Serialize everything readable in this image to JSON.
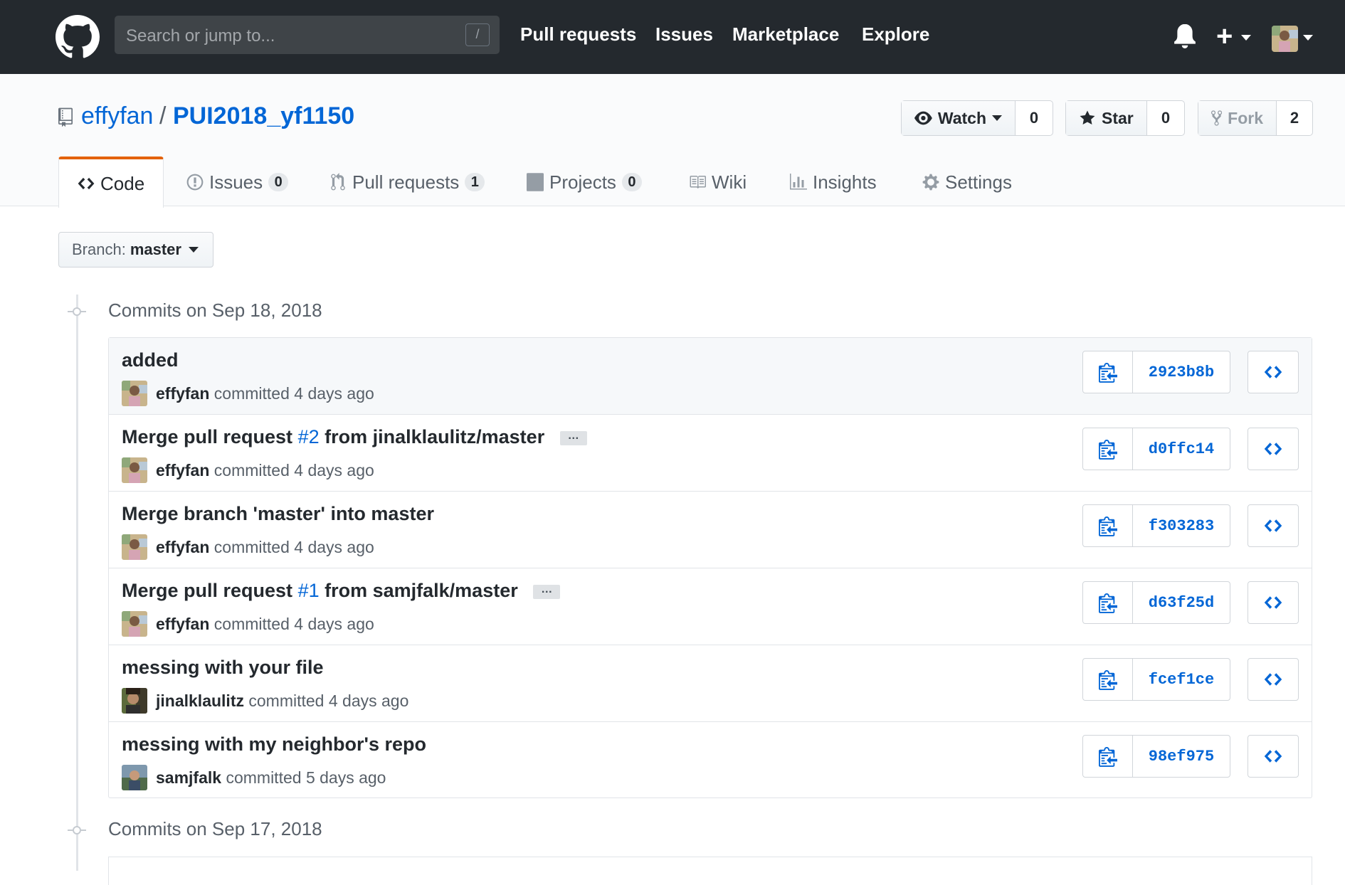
{
  "header": {
    "search_placeholder": "Search or jump to...",
    "search_shortcut": "/",
    "nav": [
      "Pull requests",
      "Issues",
      "Marketplace",
      "Explore"
    ],
    "plus_label": "+"
  },
  "repo": {
    "owner": "effyfan",
    "separator": "/",
    "name": "PUI2018_yf1150",
    "watch": {
      "label": "Watch",
      "count": "0"
    },
    "star": {
      "label": "Star",
      "count": "0"
    },
    "fork": {
      "label": "Fork",
      "count": "2"
    }
  },
  "tabs": [
    {
      "label": "Code"
    },
    {
      "label": "Issues",
      "count": "0"
    },
    {
      "label": "Pull requests",
      "count": "1"
    },
    {
      "label": "Projects",
      "count": "0"
    },
    {
      "label": "Wiki"
    },
    {
      "label": "Insights"
    },
    {
      "label": "Settings"
    }
  ],
  "branch": {
    "prefix": "Branch:",
    "name": "master"
  },
  "commit_groups": [
    {
      "title": "Commits on Sep 18, 2018",
      "commits": [
        {
          "title": "added",
          "author": "effyfan",
          "verb": "committed",
          "time": "4 days ago",
          "sha": "2923b8b"
        },
        {
          "title_pre": "Merge pull request ",
          "pr": "#2",
          "title_post": " from jinalklaulitz/master",
          "ellipsis": "…",
          "author": "effyfan",
          "verb": "committed",
          "time": "4 days ago",
          "sha": "d0ffc14"
        },
        {
          "title": "Merge branch 'master' into master",
          "author": "effyfan",
          "verb": "committed",
          "time": "4 days ago",
          "sha": "f303283"
        },
        {
          "title_pre": "Merge pull request ",
          "pr": "#1",
          "title_post": " from samjfalk/master",
          "ellipsis": "…",
          "author": "effyfan",
          "verb": "committed",
          "time": "4 days ago",
          "sha": "d63f25d"
        },
        {
          "title": "messing with your file",
          "author": "jinalklaulitz",
          "verb": "committed",
          "time": "4 days ago",
          "sha": "fcef1ce"
        },
        {
          "title": "messing with my neighbor's repo",
          "author": "samjfalk",
          "verb": "committed",
          "time": "5 days ago",
          "sha": "98ef975"
        }
      ]
    },
    {
      "title": "Commits on Sep 17, 2018"
    }
  ],
  "colors": {
    "link": "#0366d6",
    "header_bg": "#24292e",
    "tab_accent": "#e36209"
  }
}
